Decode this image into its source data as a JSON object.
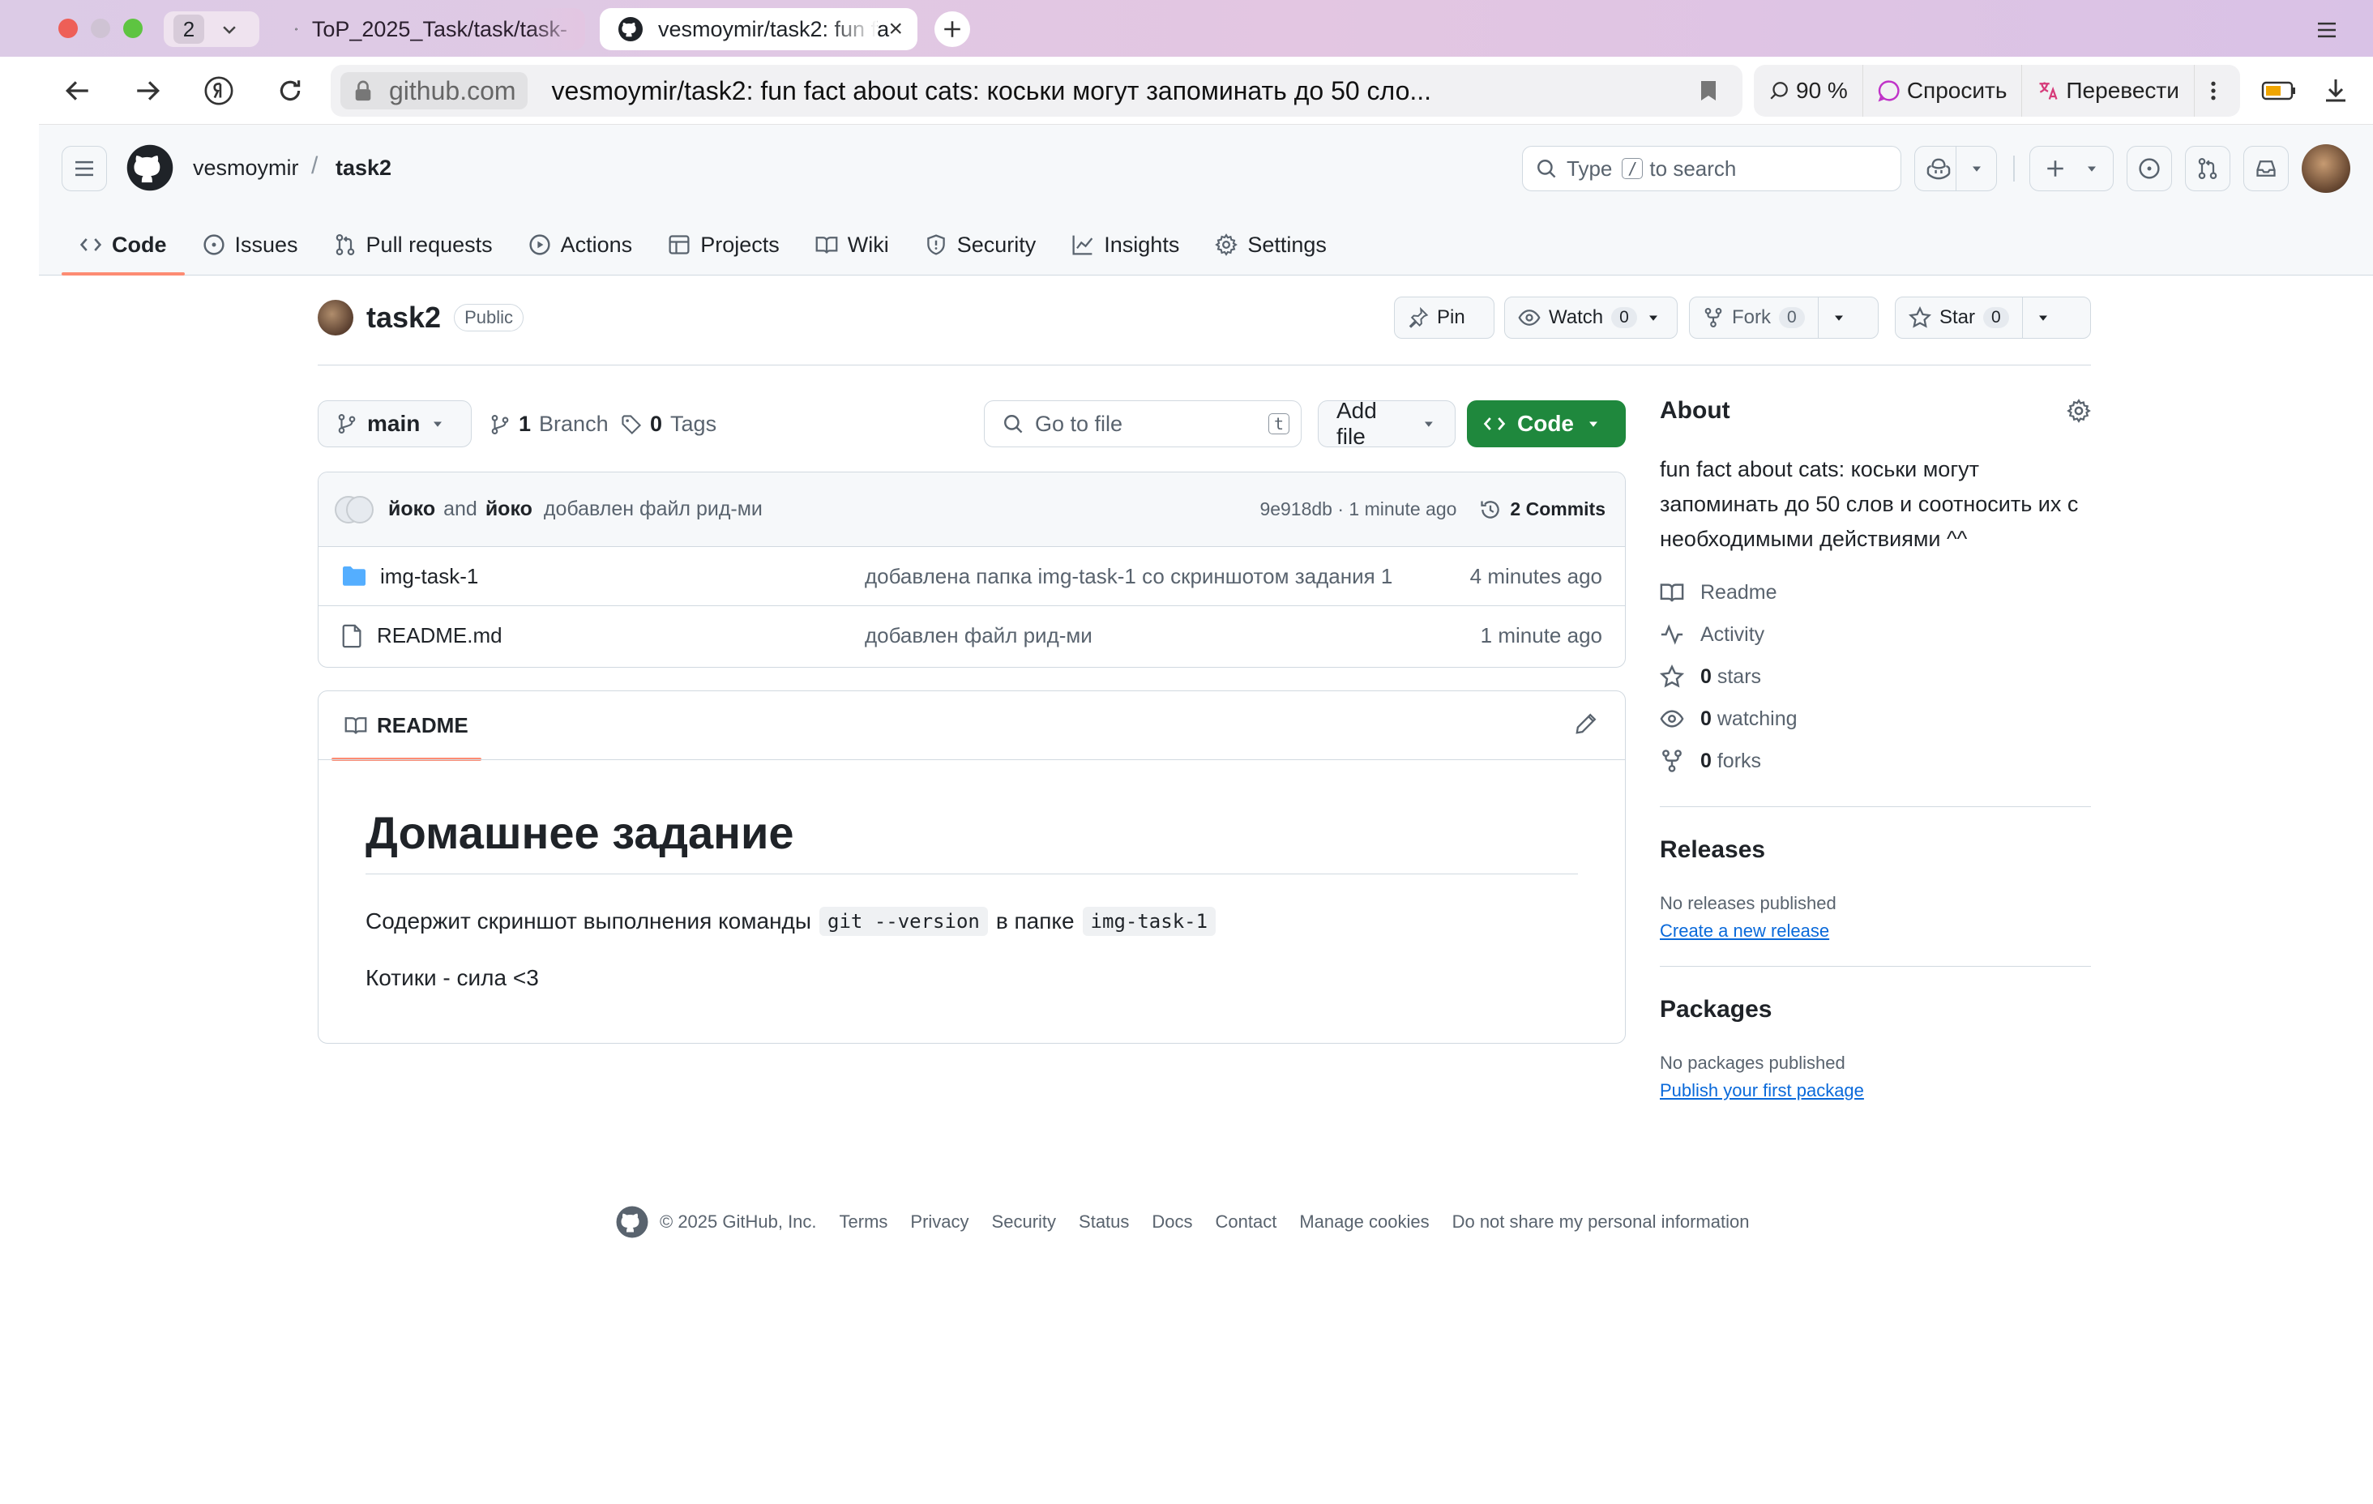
{
  "browser": {
    "tab_count": "2",
    "tabs": [
      {
        "title": "ToP_2025_Task/task/task-"
      },
      {
        "title": "vesmoymir/task2: fun fa"
      }
    ],
    "address": {
      "domain": "github.com",
      "page_title": "vesmoymir/task2: fun fact about cats: коськи могут запоминать до 50 сло..."
    },
    "zoom": "90 %",
    "ask_label": "Спросить",
    "translate_label": "Перевести"
  },
  "header": {
    "owner": "vesmoymir",
    "separator": "/",
    "repo": "task2",
    "search_placeholder_pre": "Type",
    "search_key": "/",
    "search_placeholder_post": "to search"
  },
  "nav": {
    "items": [
      {
        "label": "Code"
      },
      {
        "label": "Issues"
      },
      {
        "label": "Pull requests"
      },
      {
        "label": "Actions"
      },
      {
        "label": "Projects"
      },
      {
        "label": "Wiki"
      },
      {
        "label": "Security"
      },
      {
        "label": "Insights"
      },
      {
        "label": "Settings"
      }
    ]
  },
  "repo": {
    "name": "task2",
    "visibility": "Public",
    "pin_label": "Pin",
    "watch_label": "Watch",
    "watch_count": "0",
    "fork_label": "Fork",
    "fork_count": "0",
    "star_label": "Star",
    "star_count": "0"
  },
  "files": {
    "branch": "main",
    "branch_count": "1",
    "branch_label": "Branch",
    "tag_count": "0",
    "tag_label": "Tags",
    "goto_placeholder": "Go to file",
    "goto_key": "t",
    "add_file_label": "Add file",
    "code_label": "Code",
    "commit": {
      "author1": "йоко",
      "and": "and",
      "author2": "йоко",
      "message": "добавлен файл рид-ми",
      "hash_time": "9e918db · 1 minute ago",
      "commits_label": "2 Commits"
    },
    "rows": [
      {
        "name": "img-task-1",
        "message": "добавлена папка img-task-1 со скриншотом задания 1",
        "date": "4 minutes ago"
      },
      {
        "name": "README.md",
        "message": "добавлен файл рид-ми",
        "date": "1 minute ago"
      }
    ]
  },
  "readme": {
    "tab_label": "README",
    "h1": "Домашнее задание",
    "p1_pre": "Содержит скриншот выполнения команды",
    "p1_code1": "git --version",
    "p1_mid": "в папке",
    "p1_code2": "img-task-1",
    "p2": "Котики - сила <3"
  },
  "about": {
    "title": "About",
    "description": "fun fact about cats: коськи могут запоминать до 50 слов и соотносить их с необходимыми действиями ^^",
    "readme_label": "Readme",
    "activity_label": "Activity",
    "stars_count": "0",
    "stars_label": "stars",
    "watching_count": "0",
    "watching_label": "watching",
    "forks_count": "0",
    "forks_label": "forks"
  },
  "releases": {
    "title": "Releases",
    "empty": "No releases published",
    "link": "Create a new release"
  },
  "packages": {
    "title": "Packages",
    "empty": "No packages published",
    "link": "Publish your first package"
  },
  "footer": {
    "copyright": "© 2025 GitHub, Inc.",
    "links": [
      "Terms",
      "Privacy",
      "Security",
      "Status",
      "Docs",
      "Contact",
      "Manage cookies",
      "Do not share my personal information"
    ]
  },
  "colors": {
    "accent_green": "#1f883d",
    "nav_underline": "#fd8c73",
    "link_blue": "#0969da",
    "folder_blue": "#54aeff"
  }
}
